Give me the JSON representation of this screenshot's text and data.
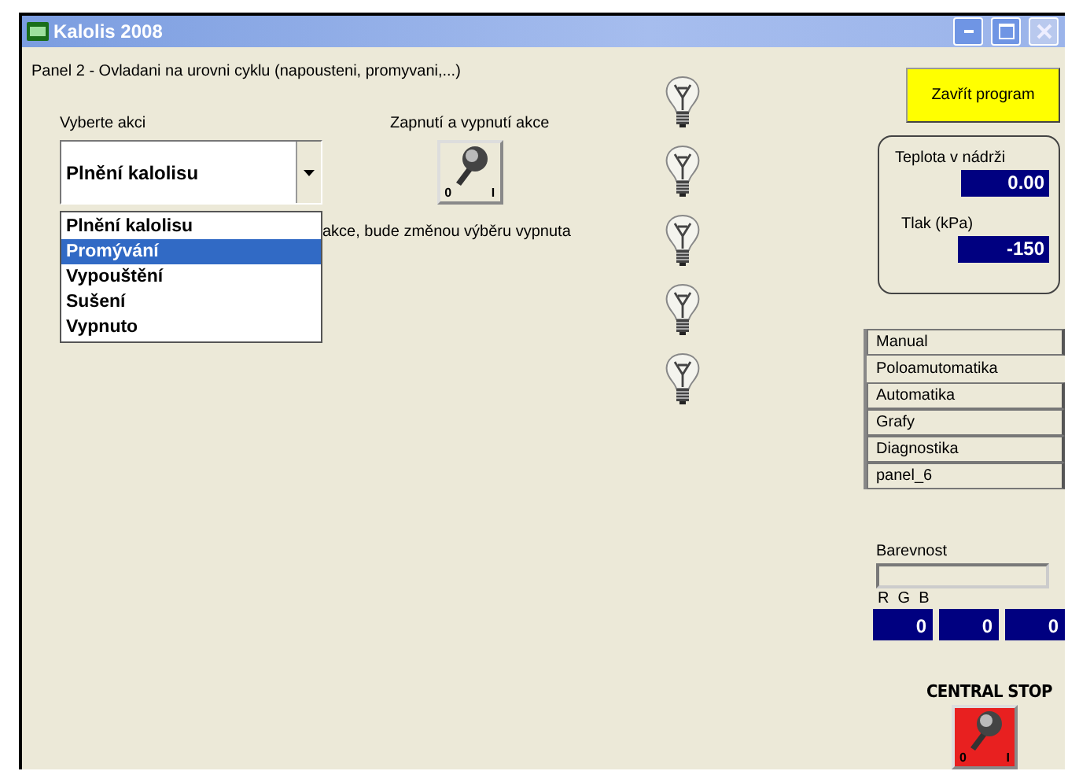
{
  "window": {
    "title": "Kalolis 2008"
  },
  "panel_label": "Panel 2 - Ovladani na urovni cyklu (napousteni, promyvani,...)",
  "action_select": {
    "label": "Vyberte akci",
    "value": "Plnění kalolisu",
    "expanded": true,
    "options": [
      {
        "label": "Plnění kalolisu",
        "highlighted": false
      },
      {
        "label": "Promývání",
        "highlighted": true
      },
      {
        "label": "Vypouštění",
        "highlighted": false
      },
      {
        "label": "Sušení",
        "highlighted": false
      },
      {
        "label": "Vypnuto",
        "highlighted": false
      }
    ]
  },
  "action_switch": {
    "label": "Zapnutí a vypnutí akce",
    "off_label": "0",
    "on_label": "I",
    "on": false
  },
  "note": "akce, bude změnou výběru vypnuta",
  "bulbs": [
    {
      "on": false
    },
    {
      "on": false
    },
    {
      "on": false
    },
    {
      "on": false
    },
    {
      "on": false
    }
  ],
  "close_button": "Zavřít program",
  "readings": [
    {
      "label": "Teplota v nádrži",
      "value": "0.00"
    },
    {
      "label": "Tlak (kPa)",
      "value": "-150"
    }
  ],
  "tabs": [
    {
      "label": "Manual",
      "selected": false
    },
    {
      "label": "Poloamutomatika",
      "selected": true
    },
    {
      "label": "Automatika",
      "selected": false
    },
    {
      "label": "Grafy",
      "selected": false
    },
    {
      "label": "Diagnostika",
      "selected": false
    },
    {
      "label": "panel_6",
      "selected": false
    }
  ],
  "color": {
    "label": "Barevnost",
    "channels_label": "R  G  B",
    "channels": [
      {
        "value": "0"
      },
      {
        "value": "0"
      },
      {
        "value": "0"
      }
    ]
  },
  "central_stop": {
    "label": "CENTRAL STOP",
    "off_label": "0",
    "on_label": "I",
    "on": false
  }
}
